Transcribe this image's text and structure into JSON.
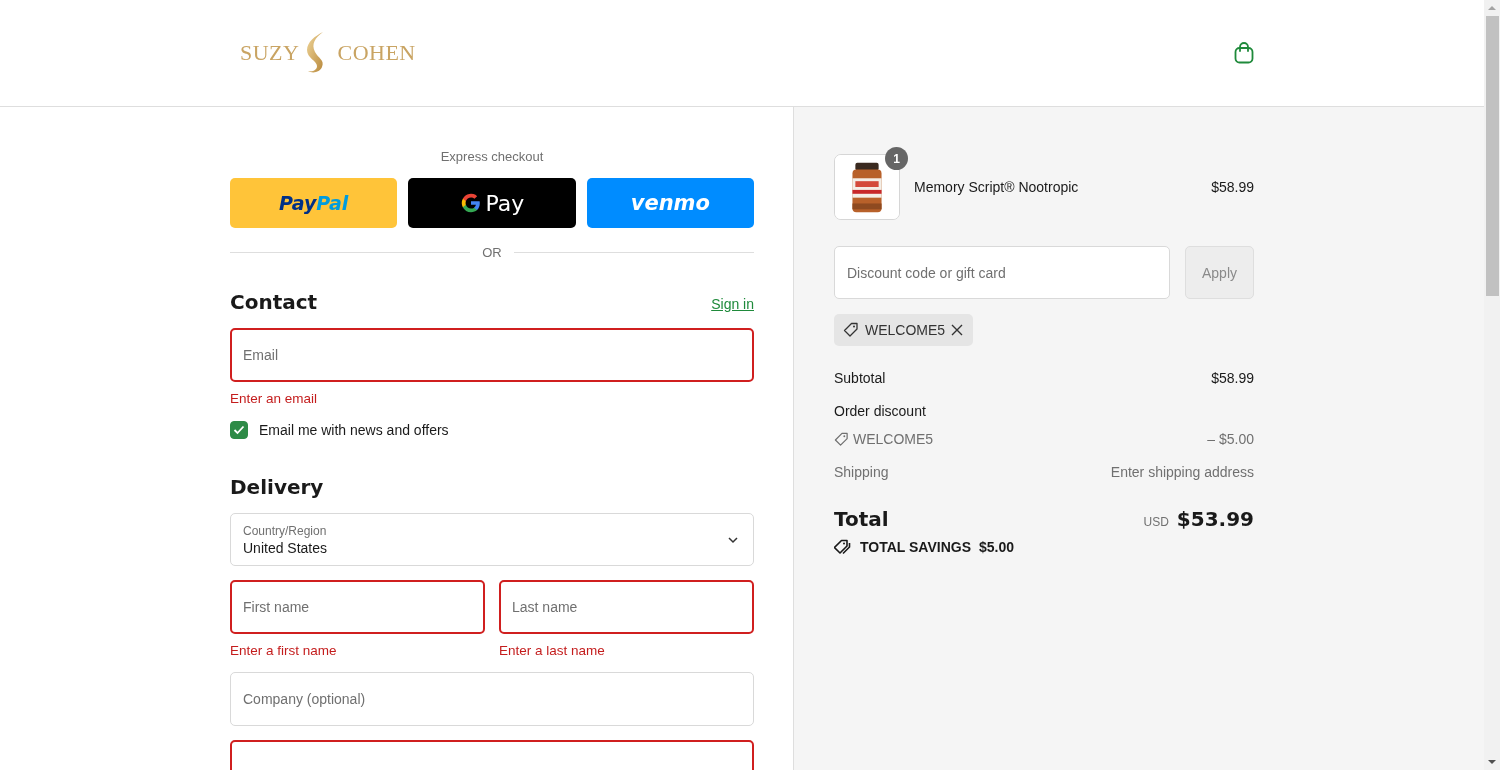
{
  "header": {
    "logo": {
      "left": "SUZY",
      "right": "COHEN"
    }
  },
  "express": {
    "title": "Express checkout",
    "buttons": [
      {
        "kind": "paypal",
        "parts": [
          "Pay",
          "Pal"
        ]
      },
      {
        "kind": "gpay",
        "parts": [
          "Pay"
        ]
      },
      {
        "kind": "venmo",
        "parts": [
          "venmo"
        ]
      }
    ],
    "divider": "OR"
  },
  "contact": {
    "title": "Contact",
    "link": "Sign in",
    "field": {
      "placeholder": "Email",
      "invalid": true,
      "error": "Enter an email"
    },
    "newsletter": {
      "label": "Email me with news and offers",
      "checked": true
    }
  },
  "delivery": {
    "title": "Delivery",
    "country": {
      "label": "Country/Region",
      "value": "United States"
    },
    "rows": [
      [
        {
          "placeholder": "First name",
          "invalid": true,
          "error": "Enter a first name"
        },
        {
          "placeholder": "Last name",
          "invalid": true,
          "error": "Enter a last name"
        }
      ],
      [
        {
          "placeholder": "Company (optional)",
          "invalid": false
        }
      ],
      [
        {
          "invalid": true
        }
      ]
    ]
  },
  "summary": {
    "items": [
      {
        "name": "Memory Script® Nootropic",
        "price": "$58.99",
        "quantity": "1"
      }
    ],
    "discount": {
      "placeholder": "Discount code or gift card",
      "button": "Apply",
      "disabled": true
    },
    "applied_codes": [
      {
        "code": "WELCOME5"
      }
    ],
    "lines": [
      {
        "kind": "amount",
        "label": "Subtotal",
        "value": "$58.99"
      },
      {
        "kind": "heading",
        "label": "Order discount"
      },
      {
        "kind": "code",
        "label": "WELCOME5",
        "value": "– $5.00"
      },
      {
        "kind": "muted",
        "label": "Shipping",
        "value": "Enter shipping address"
      }
    ],
    "total": {
      "label": "Total",
      "currency": "USD",
      "value": "$53.99"
    },
    "savings": {
      "label": "TOTAL SAVINGS",
      "value": "$5.00"
    }
  }
}
